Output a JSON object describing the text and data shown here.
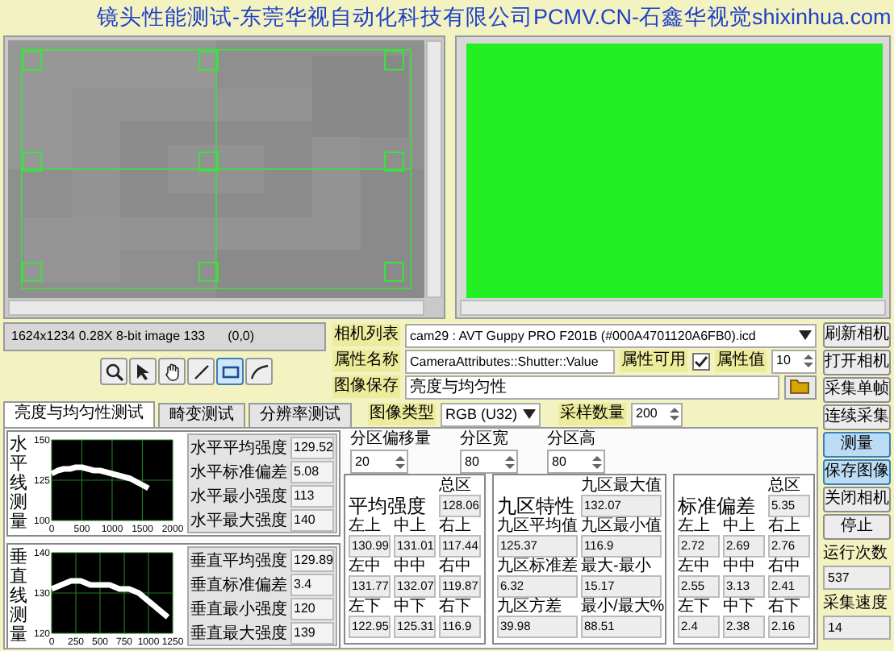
{
  "window": {
    "title": "镜头性能测试-东莞华视自动化科技有限公司PCMV.CN-石鑫华视觉shixinhua.com"
  },
  "status": {
    "text": "1624x1234 0.28X 8-bit image 133",
    "coords": "(0,0)"
  },
  "tools": [
    {
      "kind": "zoom",
      "selected": false
    },
    {
      "kind": "pointer",
      "selected": false
    },
    {
      "kind": "pan",
      "selected": false
    },
    {
      "kind": "line",
      "selected": false
    },
    {
      "kind": "rectangle",
      "selected": true
    },
    {
      "kind": "freeline",
      "selected": false
    }
  ],
  "camera": {
    "list_label": "相机列表",
    "camera": "cam29 : AVT Guppy PRO F201B (#000A4701120A6FB0).icd",
    "attribute_label": "属性名称",
    "attribute": "CameraAttributes::Shutter::Value",
    "available_label": "属性可用",
    "available": true,
    "value_label": "属性值",
    "value": "10",
    "save_label": "图像保存",
    "save_path": "亮度与均匀性"
  },
  "tabs": [
    {
      "label": "亮度与均匀性测试",
      "selected": true
    },
    {
      "label": "畸变测试",
      "selected": false
    },
    {
      "label": "分辨率测试",
      "selected": false
    }
  ],
  "image_type": {
    "label": "图像类型",
    "value": "RGB (U32)"
  },
  "sample_count": {
    "label": "采样数量",
    "value": "200"
  },
  "line_measurements": [
    {
      "label": "水平线测量",
      "chart_data": {
        "type": "line",
        "x": [
          0,
          100,
          200,
          300,
          400,
          500,
          600,
          700,
          800,
          900,
          1000,
          1100,
          1200,
          1300,
          1400,
          1500,
          1600
        ],
        "xlim": [
          0,
          2000
        ],
        "ylim": [
          100,
          150
        ],
        "xticks": [
          0,
          500,
          1000,
          1500,
          2000
        ],
        "yticks": [
          100,
          125,
          150
        ],
        "grid": true,
        "series": [
          {
            "color": "#ffffff",
            "values": [
              129,
              131,
              132,
              132,
              133,
              133,
              132,
              131,
              131,
              130,
              129,
              128,
              127,
              126,
              124,
              122,
              120
            ]
          }
        ]
      },
      "stats": [
        {
          "label": "水平平均强度",
          "value": "129.52"
        },
        {
          "label": "水平标准偏差",
          "value": "5.08"
        },
        {
          "label": "水平最小强度",
          "value": "113"
        },
        {
          "label": "水平最大强度",
          "value": "140"
        }
      ]
    },
    {
      "label": "垂直线测量",
      "chart_data": {
        "type": "line",
        "x": [
          0,
          100,
          200,
          300,
          400,
          500,
          600,
          700,
          800,
          900,
          1000,
          1100,
          1200
        ],
        "xlim": [
          0,
          1250
        ],
        "ylim": [
          120,
          140
        ],
        "xticks": [
          0,
          250,
          500,
          750,
          1000,
          1250
        ],
        "yticks": [
          120,
          130,
          140
        ],
        "grid": true,
        "series": [
          {
            "color": "#ffffff",
            "values": [
              131,
              132,
              133,
              133,
              132,
              132,
              132,
              131,
              131,
              130,
              128,
              126,
              124
            ]
          }
        ]
      },
      "stats": [
        {
          "label": "垂直平均强度",
          "value": "129.89"
        },
        {
          "label": "垂直标准偏差",
          "value": "3.4"
        },
        {
          "label": "垂直最小强度",
          "value": "120"
        },
        {
          "label": "垂直最大强度",
          "value": "139"
        }
      ]
    }
  ],
  "partition": [
    {
      "label": "分区偏移量",
      "value": "20"
    },
    {
      "label": "分区宽",
      "value": "80"
    },
    {
      "label": "分区高",
      "value": "80"
    }
  ],
  "panels": [
    {
      "kind": "grid",
      "title": "平均强度",
      "total_label": "总区",
      "total": "128.06",
      "cells": [
        {
          "label": "左上",
          "value": "130.99"
        },
        {
          "label": "中上",
          "value": "131.01"
        },
        {
          "label": "右上",
          "value": "117.44"
        },
        {
          "label": "左中",
          "value": "131.77"
        },
        {
          "label": "中中",
          "value": "132.07"
        },
        {
          "label": "右中",
          "value": "119.87"
        },
        {
          "label": "左下",
          "value": "122.95"
        },
        {
          "label": "中下",
          "value": "125.31"
        },
        {
          "label": "右下",
          "value": "116.9"
        }
      ]
    },
    {
      "kind": "pairs",
      "title": "九区特性",
      "total_label": "九区最大值",
      "total": "132.07",
      "cells": [
        {
          "label": "九区平均值",
          "value": "125.37"
        },
        {
          "label": "九区最小值",
          "value": "116.9"
        },
        {
          "label": "九区标准差",
          "value": "6.32"
        },
        {
          "label": "最大-最小",
          "value": "15.17"
        },
        {
          "label": "九区方差",
          "value": "39.98"
        },
        {
          "label": "最小/最大%",
          "value": "88.51"
        }
      ]
    },
    {
      "kind": "grid",
      "title": "标准偏差",
      "total_label": "总区",
      "total": "5.35",
      "cells": [
        {
          "label": "左上",
          "value": "2.72"
        },
        {
          "label": "中上",
          "value": "2.69"
        },
        {
          "label": "右上",
          "value": "2.76"
        },
        {
          "label": "左中",
          "value": "2.55"
        },
        {
          "label": "中中",
          "value": "3.13"
        },
        {
          "label": "右中",
          "value": "2.41"
        },
        {
          "label": "左下",
          "value": "2.4"
        },
        {
          "label": "中下",
          "value": "2.38"
        },
        {
          "label": "右下",
          "value": "2.16"
        }
      ]
    }
  ],
  "buttons": [
    {
      "label": "刷新相机",
      "active": false
    },
    {
      "label": "打开相机",
      "active": false
    },
    {
      "label": "采集单帧",
      "active": false
    },
    {
      "label": "连续采集",
      "active": false
    },
    {
      "label": "测量",
      "active": true
    },
    {
      "label": "保存图像",
      "active": true
    },
    {
      "label": "关闭相机",
      "active": false
    },
    {
      "label": "停止",
      "active": false
    }
  ],
  "counters": [
    {
      "label": "运行次数",
      "value": "537"
    },
    {
      "label": "采集速度",
      "value": "14"
    }
  ]
}
